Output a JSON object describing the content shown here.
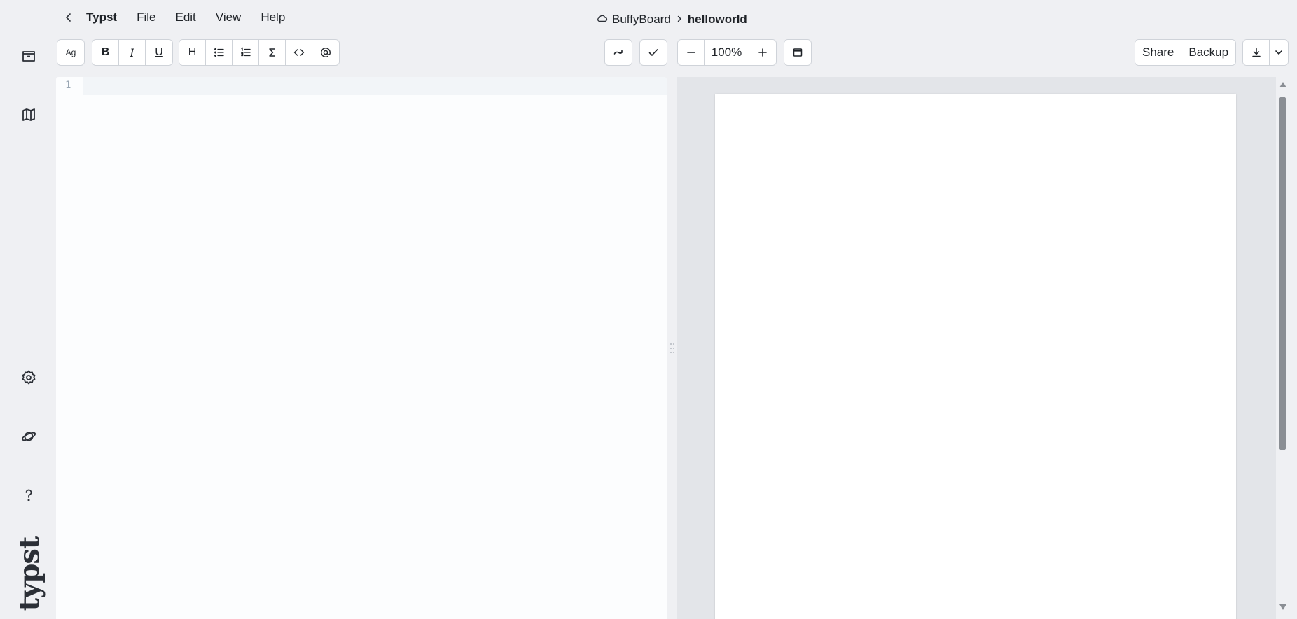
{
  "sidebar": {
    "items": [
      {
        "name": "archive-icon",
        "label": "Files"
      },
      {
        "name": "map-icon",
        "label": "Outline"
      },
      {
        "name": "gear-icon",
        "label": "Settings"
      },
      {
        "name": "planet-icon",
        "label": "Explore"
      },
      {
        "name": "help-icon",
        "label": "Help"
      }
    ],
    "logo": "typst"
  },
  "menubar": {
    "brand": "Typst",
    "items": [
      "File",
      "Edit",
      "View",
      "Help"
    ]
  },
  "breadcrumb": {
    "parent": "BuffyBoard",
    "current": "helloworld"
  },
  "toolbar": {
    "font_label": "Ag",
    "bold": "B",
    "italic": "I",
    "underline": "U",
    "heading": "H",
    "zoom": "100%",
    "share": "Share",
    "backup": "Backup"
  },
  "editor": {
    "lines": [
      ""
    ],
    "line_numbers": [
      "1"
    ]
  },
  "colors": {
    "background": "#eff0f3",
    "editor_bg": "#fcfdfe",
    "preview_bg": "#e3e5e9",
    "page": "#ffffff",
    "gutter_border": "#9fb6c8"
  }
}
